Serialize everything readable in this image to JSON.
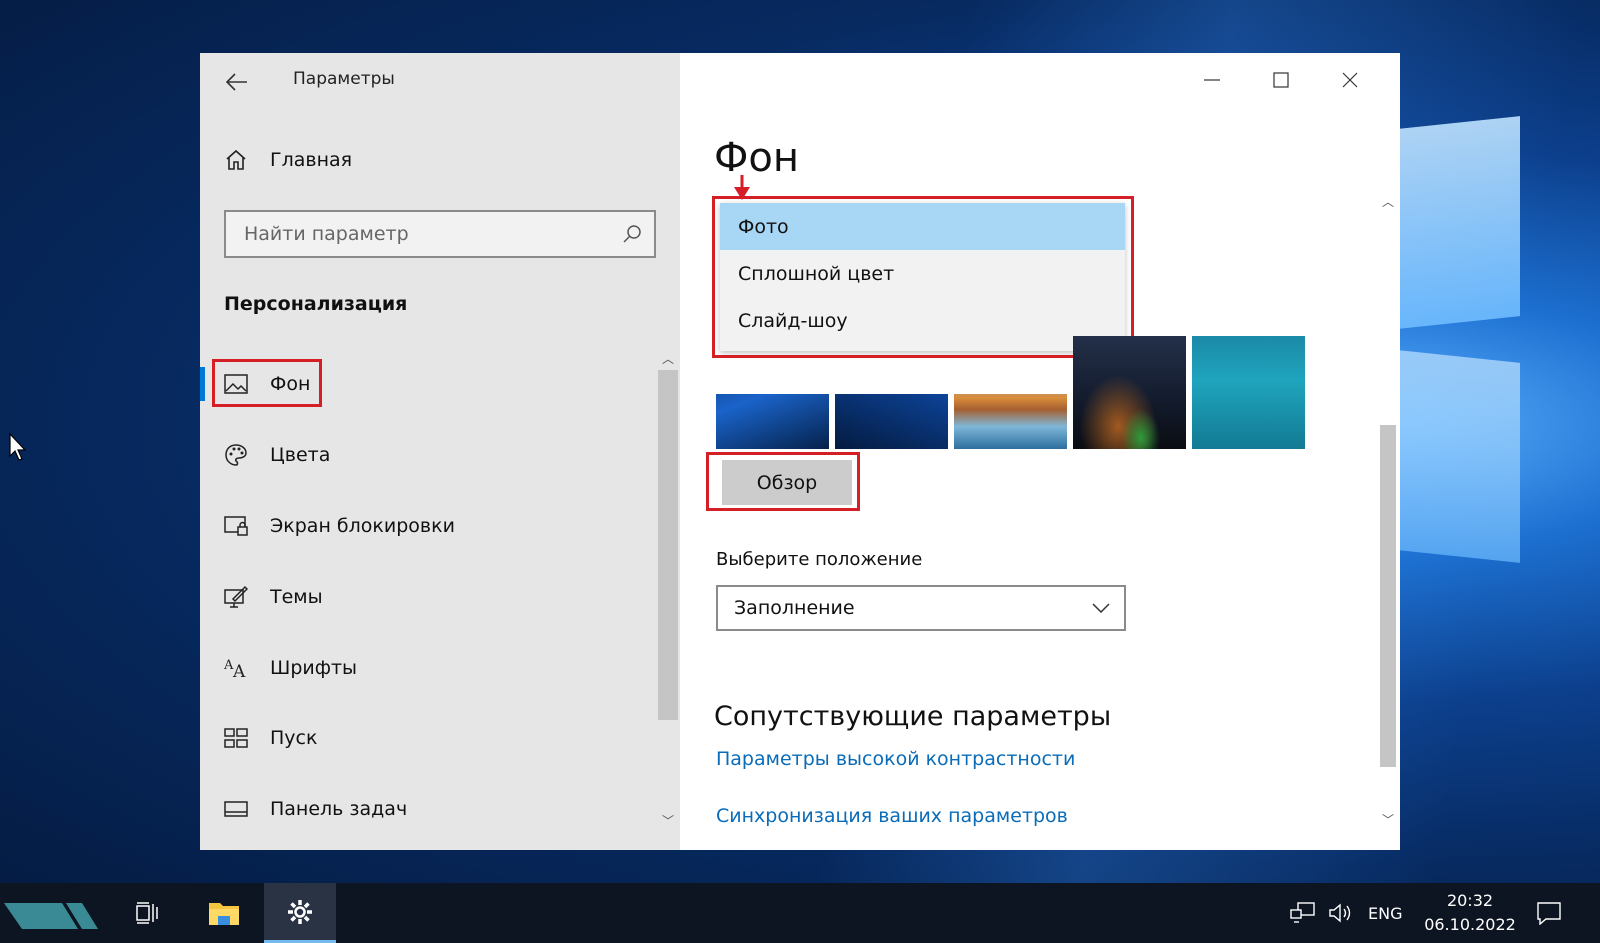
{
  "window": {
    "title": "Параметры",
    "caption": {
      "minimize": "minimize",
      "maximize": "maximize",
      "close": "close"
    }
  },
  "sidebar": {
    "home_label": "Главная",
    "search_placeholder": "Найти параметр",
    "section_title": "Персонализация",
    "items": [
      {
        "label": "Фон",
        "icon": "picture-icon",
        "active": true
      },
      {
        "label": "Цвета",
        "icon": "palette-icon",
        "active": false
      },
      {
        "label": "Экран блокировки",
        "icon": "lock-screen-icon",
        "active": false
      },
      {
        "label": "Темы",
        "icon": "themes-icon",
        "active": false
      },
      {
        "label": "Шрифты",
        "icon": "fonts-icon",
        "active": false
      },
      {
        "label": "Пуск",
        "icon": "start-icon",
        "active": false
      },
      {
        "label": "Панель задач",
        "icon": "taskbar-icon",
        "active": false
      }
    ]
  },
  "main": {
    "title": "Фон",
    "background_dropdown": {
      "options": [
        "Фото",
        "Сплошной цвет",
        "Слайд-шоу"
      ],
      "selected": "Фото"
    },
    "browse_label": "Обзор",
    "position_label": "Выберите положение",
    "position_value": "Заполнение",
    "related_title": "Сопутствующие параметры",
    "links": [
      "Параметры высокой контрастности",
      "Синхронизация ваших параметров"
    ]
  },
  "taskbar": {
    "language": "ENG",
    "time": "20:32",
    "date": "06.10.2022"
  },
  "colors": {
    "accent": "#0078d7",
    "highlight_box": "#d41f27",
    "link": "#0a6cb8",
    "selected_option": "#a8d7f5"
  }
}
